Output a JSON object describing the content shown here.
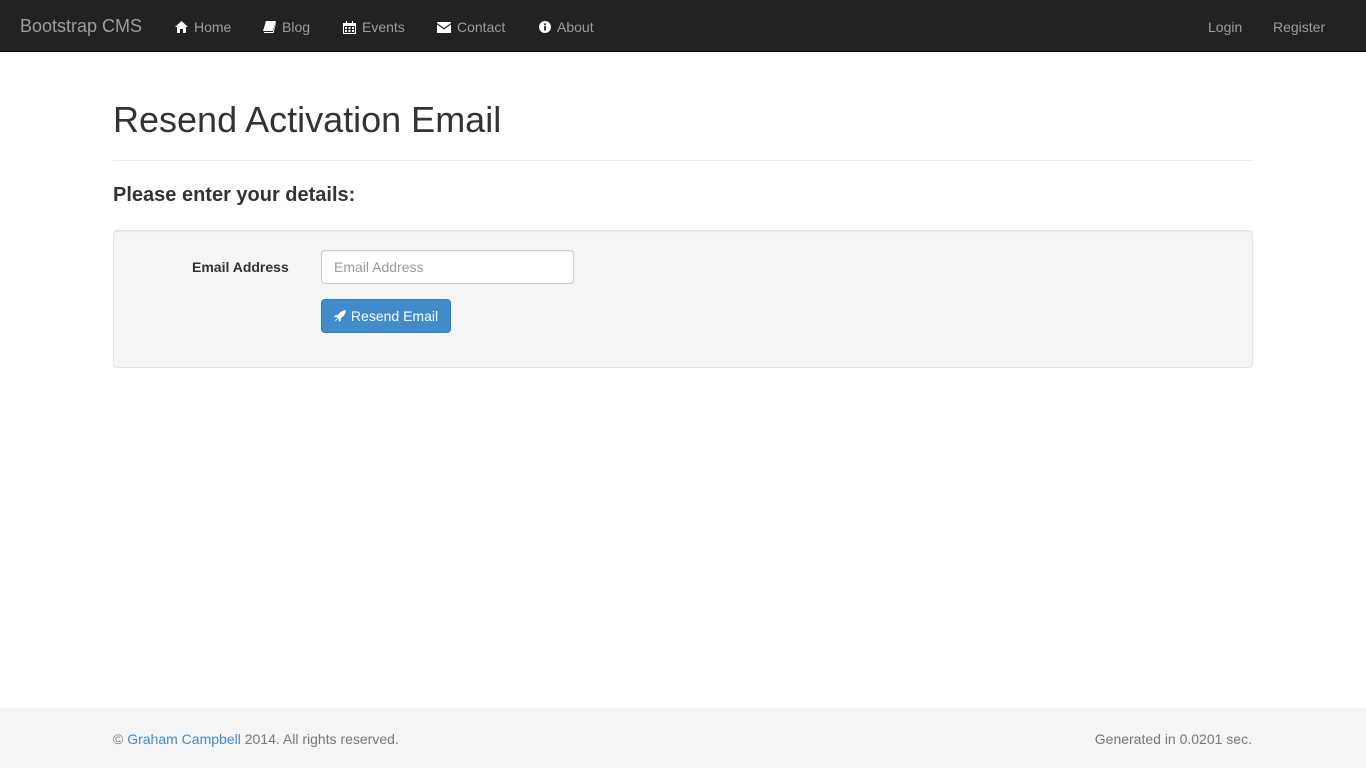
{
  "navbar": {
    "brand": "Bootstrap CMS",
    "items": [
      {
        "label": "Home",
        "icon": "home-icon"
      },
      {
        "label": "Blog",
        "icon": "book-icon"
      },
      {
        "label": "Events",
        "icon": "calendar-icon"
      },
      {
        "label": "Contact",
        "icon": "envelope-icon"
      },
      {
        "label": "About",
        "icon": "info-circle-icon"
      }
    ],
    "right_items": [
      {
        "label": "Login"
      },
      {
        "label": "Register"
      }
    ]
  },
  "main": {
    "title": "Resend Activation Email",
    "subtitle": "Please enter your details:",
    "form": {
      "email_label": "Email Address",
      "email_placeholder": "Email Address",
      "email_value": "",
      "submit_label": "Resend Email",
      "submit_icon": "rocket-icon"
    }
  },
  "footer": {
    "copyright_symbol": "©",
    "author_link": "Graham Campbell",
    "copyright_suffix": "2014. All rights reserved.",
    "generated": "Generated in 0.0201 sec."
  },
  "colors": {
    "navbar_bg": "#222222",
    "nav_text": "#9d9d9d",
    "primary": "#428bca",
    "well_bg": "#f5f5f5",
    "footer_bg": "#f5f5f5"
  }
}
